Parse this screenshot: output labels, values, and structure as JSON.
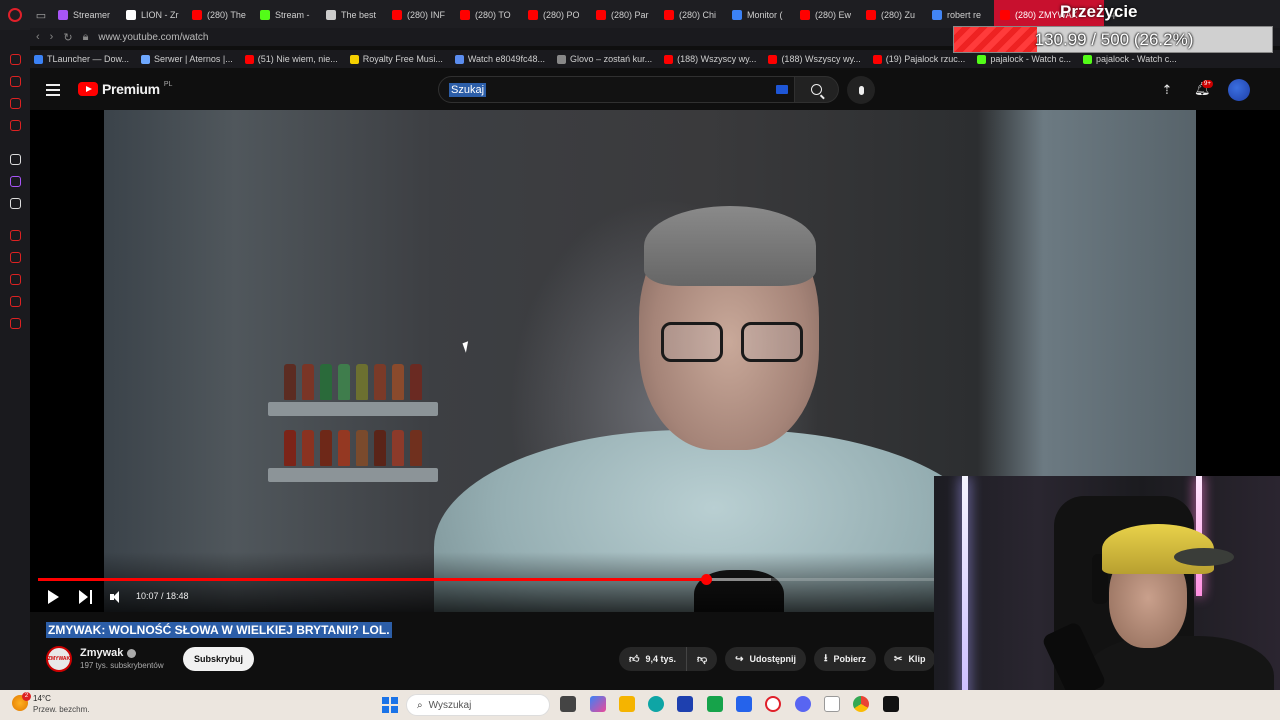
{
  "browser": {
    "tabs": [
      {
        "label": "Streamer",
        "color": "#a855f7"
      },
      {
        "label": "LION - Zr",
        "color": "#ffffff"
      },
      {
        "label": "(280) The",
        "color": "#ff0000"
      },
      {
        "label": "Stream -",
        "color": "#53fc18"
      },
      {
        "label": "The best",
        "color": "#cccccc"
      },
      {
        "label": "(280) INF",
        "color": "#ff0000"
      },
      {
        "label": "(280) TO",
        "color": "#ff0000"
      },
      {
        "label": "(280) PO",
        "color": "#ff0000"
      },
      {
        "label": "(280) Par",
        "color": "#ff0000"
      },
      {
        "label": "(280) Chi",
        "color": "#ff0000"
      },
      {
        "label": "Monitor (",
        "color": "#3b82f6"
      },
      {
        "label": "(280) Ew",
        "color": "#ff0000"
      },
      {
        "label": "(280) Zu",
        "color": "#ff0000"
      },
      {
        "label": "robert re",
        "color": "#4285f4"
      },
      {
        "label": "(280) ZMYWAK",
        "color": "#ff0000"
      }
    ],
    "address": "www.youtube.com/watch",
    "bookmarks": [
      {
        "label": "TLauncher — Dow...",
        "color": "#3b82f6"
      },
      {
        "label": "Serwer | Aternos |...",
        "color": "#6ea8ff"
      },
      {
        "label": "(51) Nie wiem, nie...",
        "color": "#ff0000"
      },
      {
        "label": "Royalty Free Musi...",
        "color": "#f5d000"
      },
      {
        "label": "Watch e8049fc48...",
        "color": "#5b8def"
      },
      {
        "label": "Glovo – zostań kur...",
        "color": "#888888"
      },
      {
        "label": "(188) Wszyscy wy...",
        "color": "#ff0000"
      },
      {
        "label": "(188) Wszyscy wy...",
        "color": "#ff0000"
      },
      {
        "label": "(19) Pajalock rzuc...",
        "color": "#ff0000"
      },
      {
        "label": "pajalock - Watch c...",
        "color": "#53fc18"
      },
      {
        "label": "pajalock - Watch c...",
        "color": "#53fc18"
      }
    ]
  },
  "overlay": {
    "title": "Przeżycie",
    "progress_text": "130.99 / 500 (26.2%)",
    "progress_fraction": 0.262
  },
  "youtube": {
    "logo_text": "Premium",
    "logo_badge": "PL",
    "search_value": "Szukaj",
    "notifications_badge": "9+",
    "player": {
      "time": "10:07 / 18:48",
      "played_fraction": 0.538,
      "loaded_fraction": 0.59
    },
    "video_title": "ZMYWAK: WOLNOŚĆ SŁOWA W WIELKIEJ BRYTANII? LOL.",
    "channel": {
      "name": "Zmywak",
      "subscribers": "197 tys. subskrybentów",
      "avatar_text": "ZMYWAK"
    },
    "subscribe_label": "Subskrybuj",
    "actions": {
      "likes": "9,4 tys.",
      "share": "Udostępnij",
      "download": "Pobierz",
      "clip": "Klip"
    }
  },
  "taskbar": {
    "weather_temp": "14°C",
    "weather_desc": "Przew. bezchm.",
    "weather_badge": "2",
    "search_placeholder": "Wyszukaj"
  }
}
